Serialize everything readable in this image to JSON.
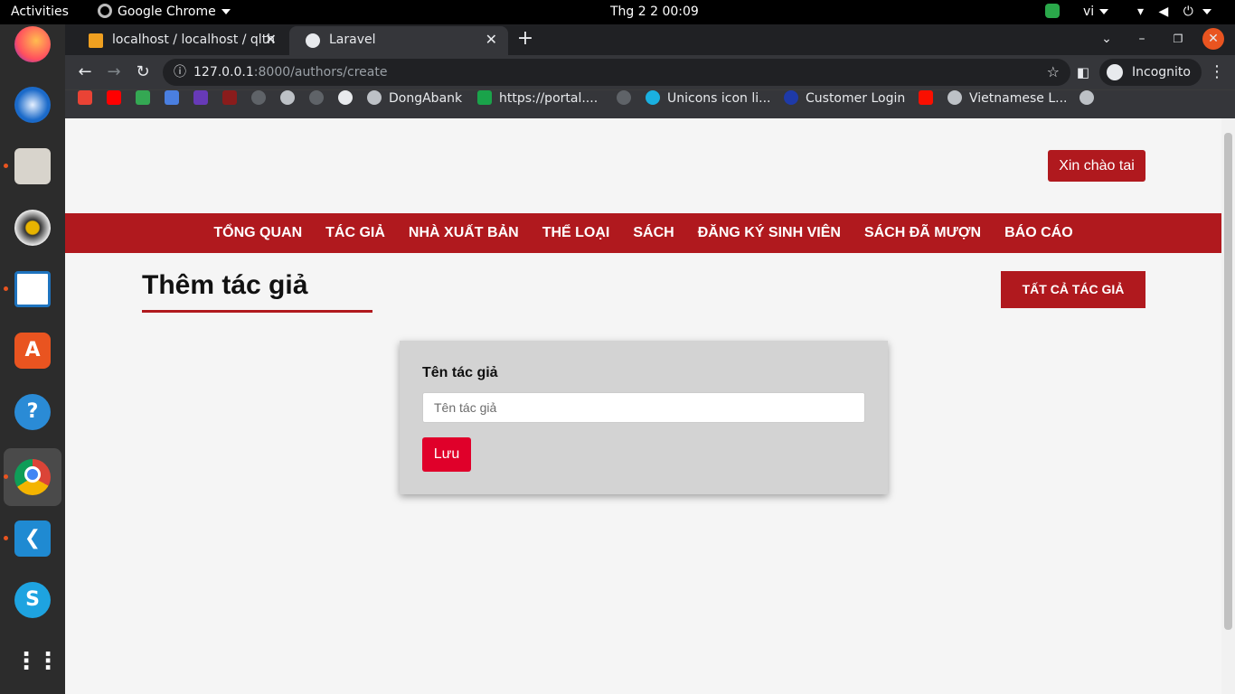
{
  "system": {
    "activities": "Activities",
    "app_menu": "Google Chrome",
    "clock": "Thg 2 2  00:09",
    "language": "vi"
  },
  "browser": {
    "tabs": [
      {
        "title": "localhost / localhost / qlth"
      },
      {
        "title": "Laravel"
      }
    ],
    "url_host": "127.0.0.1",
    "url_path": ":8000/authors/create",
    "profile_label": "Incognito",
    "bookmarks": [
      {
        "label": "DongAbank"
      },
      {
        "label": "https://portal...."
      },
      {
        "label": "Unicons icon li..."
      },
      {
        "label": "Customer Login"
      },
      {
        "label": "Vietnamese L..."
      }
    ]
  },
  "header": {
    "greeting_button": "Xin chào tai"
  },
  "nav": [
    {
      "label": "TỔNG QUAN"
    },
    {
      "label": "TÁC GIẢ"
    },
    {
      "label": "NHÀ XUẤT BẢN"
    },
    {
      "label": "THỂ LOẠI"
    },
    {
      "label": "SÁCH"
    },
    {
      "label": "ĐĂNG KÝ SINH VIÊN"
    },
    {
      "label": "SÁCH ĐÃ MƯỢN"
    },
    {
      "label": "BÁO CÁO"
    }
  ],
  "main": {
    "title": "Thêm tác giả",
    "all_authors_button": "TẤT CẢ TÁC GIẢ",
    "form": {
      "label": "Tên tác giả",
      "placeholder": "Tên tác giả",
      "value": "",
      "submit_label": "Lưu"
    }
  },
  "colors": {
    "brand_red": "#b0191e",
    "submit_red": "#e0002a",
    "form_bg": "#d3d3d3",
    "page_bg": "#f5f5f5"
  }
}
